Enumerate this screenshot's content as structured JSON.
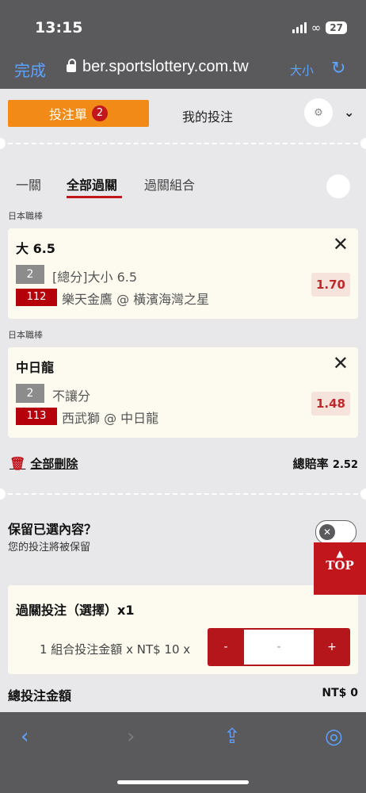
{
  "status_bar": {
    "time": "13:15",
    "battery": "27"
  },
  "browser": {
    "done": "完成",
    "url": "ber.sportslottery.com.tw",
    "text_size": "大小",
    "accent": "#5ea3ff"
  },
  "tabs": {
    "betslip": "投注單",
    "betslip_count": "2",
    "my_bets": "我的投注"
  },
  "subtabs": [
    "一關",
    "全部過關",
    "過關組合"
  ],
  "bets": [
    {
      "league": "日本職棒",
      "title": "大 6.5",
      "market_no": "2",
      "market": "[總分]大小 6.5",
      "match_no": "112",
      "match": "樂天金鷹 @ 橫濱海灣之星",
      "odds": "1.70"
    },
    {
      "league": "日本職棒",
      "title": "中日龍",
      "market_no": "2",
      "market": "不讓分",
      "match_no": "113",
      "match": "西武獅 @ 中日龍",
      "odds": "1.48"
    }
  ],
  "actions": {
    "delete_all": "全部刪除",
    "total_odds_label": "總賠率",
    "total_odds_value": "2.52"
  },
  "keep": {
    "title": "保留已選內容？",
    "subtitle": "您的投注將被保留"
  },
  "top_button": "TOP",
  "parlay": {
    "title": "過關投注（選擇）x1",
    "label": "1 組合投注金額 x NT$ 10 x",
    "minus": "-",
    "amount": "-",
    "plus": "+"
  },
  "total_bet": {
    "label": "總投注金額",
    "value": "NT$ 0"
  },
  "colors": {
    "brand_orange": "#f18a17",
    "brand_red": "#c0161c"
  }
}
